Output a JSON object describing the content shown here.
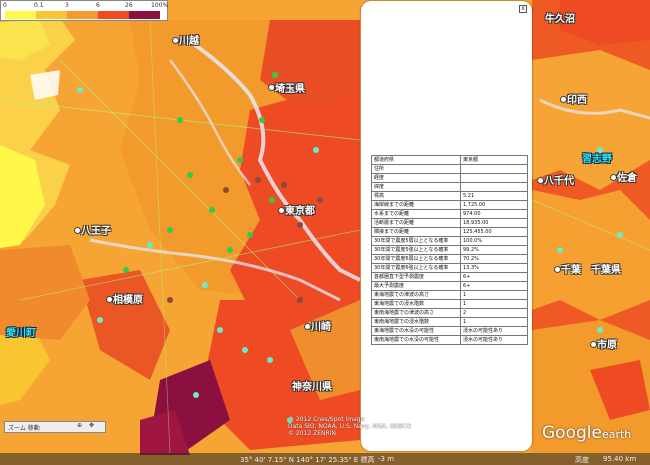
{
  "legend": {
    "ticks": [
      "0",
      "0.1",
      "3",
      "6",
      "26",
      "100%"
    ],
    "colors": [
      "#ffffff",
      "#fff84a",
      "#f9c530",
      "#f49a2e",
      "#ee4a24",
      "#8b1040"
    ]
  },
  "map_labels": [
    {
      "text": "川越",
      "cls": ""
    },
    {
      "text": "埼玉県",
      "cls": ""
    },
    {
      "text": "八王子",
      "cls": ""
    },
    {
      "text": "東京都",
      "cls": ""
    },
    {
      "text": "相模原",
      "cls": ""
    },
    {
      "text": "愛川町",
      "cls": "cyan"
    },
    {
      "text": "川崎",
      "cls": ""
    },
    {
      "text": "神奈川県",
      "cls": ""
    },
    {
      "text": "牛久沼",
      "cls": ""
    },
    {
      "text": "印西",
      "cls": ""
    },
    {
      "text": "習志野",
      "cls": "cyan"
    },
    {
      "text": "佐倉",
      "cls": ""
    },
    {
      "text": "八千代",
      "cls": ""
    },
    {
      "text": "千葉",
      "cls": ""
    },
    {
      "text": "千葉県",
      "cls": ""
    },
    {
      "text": "市原",
      "cls": ""
    }
  ],
  "popup": {
    "close": "x",
    "rows": [
      {
        "k": "都道府県",
        "v": "東京都"
      },
      {
        "k": "住所",
        "v": ""
      },
      {
        "k": "経度",
        "v": ""
      },
      {
        "k": "緯度",
        "v": ""
      },
      {
        "k": "標高",
        "v": "5.21"
      },
      {
        "k": "海岸線までの距離",
        "v": "1,725.00"
      },
      {
        "k": "水系までの距離",
        "v": "974.00"
      },
      {
        "k": "活断層までの距離",
        "v": "18,935.00"
      },
      {
        "k": "隣接までの距離",
        "v": "125,455.00"
      },
      {
        "k": "30年間で震度5弱以上となる確率",
        "v": "100.0%"
      },
      {
        "k": "30年間で震度5強以上となる確率",
        "v": "99.2%"
      },
      {
        "k": "30年間で震度6弱以上となる確率",
        "v": "70.2%"
      },
      {
        "k": "30年間で震度6強以上となる確率",
        "v": "13.3%"
      },
      {
        "k": "首都圏直下型予測震度",
        "v": "6+"
      },
      {
        "k": "最大予測震度",
        "v": "6+"
      },
      {
        "k": "東海地震での津波の高さ",
        "v": "1"
      },
      {
        "k": "東海地震での浸水階数",
        "v": "1"
      },
      {
        "k": "東南海地震での津波の高さ",
        "v": "2"
      },
      {
        "k": "東南海地震での浸水階数",
        "v": "1"
      },
      {
        "k": "東海地震での水没の可能性",
        "v": "浸水の可能性あり"
      },
      {
        "k": "東南海地震での水没の可能性",
        "v": "浸水の可能性あり"
      }
    ]
  },
  "status": {
    "coords": "35° 40' 7.15\" N 140° 17' 25.35\" E 標高",
    "elev": "-3 m",
    "eye": "高度",
    "alt": "95.40 km"
  },
  "copyright": [
    "© 2012 Cnes/Spot Image",
    "Data SIO, NOAA, U.S. Navy, NGA, GEBCO",
    "© 2012 ZENRIN"
  ],
  "tools_label": "ズーム 移動",
  "brand": {
    "main": "Google",
    "sub": "earth"
  }
}
